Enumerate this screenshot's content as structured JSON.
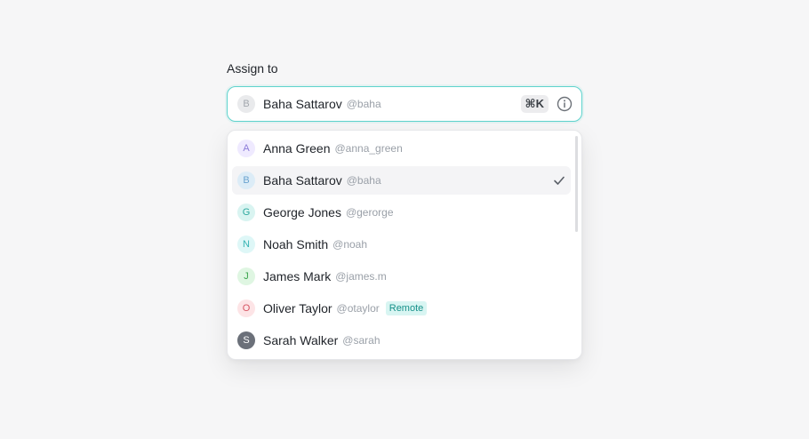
{
  "field": {
    "label": "Assign to",
    "selected": {
      "initial": "B",
      "name": "Baha Sattarov",
      "handle": "@baha"
    },
    "shortcut": "⌘K",
    "info_icon": "info-circle-icon"
  },
  "options": [
    {
      "initial": "A",
      "name": "Anna Green",
      "handle": "@anna_green",
      "avatar_bg": "#efeaff",
      "avatar_fg": "#8b7bd8"
    },
    {
      "initial": "B",
      "name": "Baha Sattarov",
      "handle": "@baha",
      "avatar_bg": "#dcecf7",
      "avatar_fg": "#6aa3cf",
      "selected": true
    },
    {
      "initial": "G",
      "name": "George Jones",
      "handle": "@gerorge",
      "avatar_bg": "#d9f4f1",
      "avatar_fg": "#2fa99f"
    },
    {
      "initial": "N",
      "name": "Noah Smith",
      "handle": "@noah",
      "avatar_bg": "#def7f7",
      "avatar_fg": "#34b3b3"
    },
    {
      "initial": "J",
      "name": "James Mark",
      "handle": "@james.m",
      "avatar_bg": "#dff6e2",
      "avatar_fg": "#3aa54c"
    },
    {
      "initial": "O",
      "name": "Oliver Taylor",
      "handle": "@otaylor",
      "avatar_bg": "#fde4e6",
      "avatar_fg": "#d65563",
      "badge": "Remote"
    },
    {
      "initial": "S",
      "name": "Sarah Walker",
      "handle": "@sarah",
      "avatar_bg": "#6b7079",
      "avatar_fg": "#ffffff"
    }
  ],
  "colors": {
    "accent": "#5fd3cd",
    "badge_bg": "#d8f5f2",
    "badge_fg": "#17918a"
  }
}
